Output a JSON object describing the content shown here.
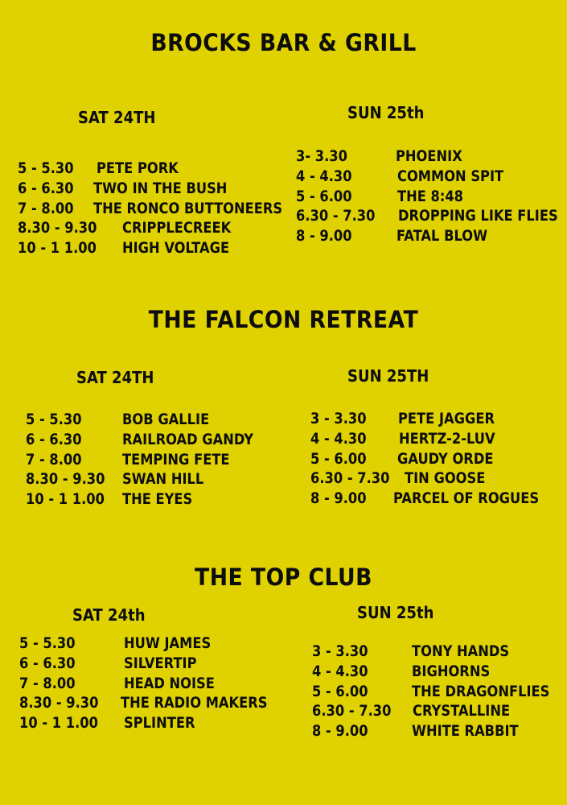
{
  "venues": [
    {
      "name": "BROCKS BAR & GRILL",
      "days": [
        {
          "label": "SAT 24TH",
          "slots": [
            {
              "time": "5 - 5.30",
              "band": "PETE PORK"
            },
            {
              "time": "6 - 6.30",
              "band": "TWO IN THE BUSH"
            },
            {
              "time": "7 - 8.00",
              "band": "THE RONCO BUTTONEERS"
            },
            {
              "time": "8.30 - 9.30",
              "band": "CRIPPLECREEK"
            },
            {
              "time": "10 - 1 1.00",
              "band": "HIGH VOLTAGE"
            }
          ]
        },
        {
          "label": "SUN 25th",
          "slots": [
            {
              "time": "3- 3.30",
              "band": "PHOENIX"
            },
            {
              "time": "4 - 4.30",
              "band": "COMMON SPIT"
            },
            {
              "time": "5 - 6.00",
              "band": "THE 8:48"
            },
            {
              "time": "6.30 - 7.30",
              "band": "DROPPING LIKE FLIES"
            },
            {
              "time": "8 - 9.00",
              "band": "FATAL BLOW"
            }
          ]
        }
      ]
    },
    {
      "name": "THE FALCON RETREAT",
      "days": [
        {
          "label": "SAT 24TH",
          "slots": [
            {
              "time": "5 - 5.30",
              "band": "BOB GALLIE"
            },
            {
              "time": "6 - 6.30",
              "band": "RAILROAD GANDY"
            },
            {
              "time": "7 - 8.00",
              "band": "TEMPING FETE"
            },
            {
              "time": "8.30 - 9.30",
              "band": "SWAN HILL"
            },
            {
              "time": "10 - 1 1.00",
              "band": "THE EYES"
            }
          ]
        },
        {
          "label": "SUN 25TH",
          "slots": [
            {
              "time": "3 - 3.30",
              "band": "PETE JAGGER"
            },
            {
              "time": "4 - 4.30",
              "band": "HERTZ-2-LUV"
            },
            {
              "time": "5 - 6.00",
              "band": "GAUDY ORDE"
            },
            {
              "time": "6.30 - 7.30",
              "band": "TIN GOOSE"
            },
            {
              "time": "8 - 9.00",
              "band": "PARCEL OF ROGUES"
            }
          ]
        }
      ]
    },
    {
      "name": "THE TOP CLUB",
      "days": [
        {
          "label": "SAT 24th",
          "slots": [
            {
              "time": "5 - 5.30",
              "band": "HUW JAMES"
            },
            {
              "time": "6 - 6.30",
              "band": "SILVERTIP"
            },
            {
              "time": "7 - 8.00",
              "band": "HEAD NOISE"
            },
            {
              "time": "8.30 - 9.30",
              "band": "THE RADIO MAKERS"
            },
            {
              "time": "10 - 1 1.00",
              "band": "SPLINTER"
            }
          ]
        },
        {
          "label": "SUN 25th",
          "slots": [
            {
              "time": "3 - 3.30",
              "band": "TONY HANDS"
            },
            {
              "time": "4 - 4.30",
              "band": "BIGHORNS"
            },
            {
              "time": "5 - 6.00",
              "band": "THE DRAGONFLIES"
            },
            {
              "time": "6.30 - 7.30",
              "band": "CRYSTALLINE"
            },
            {
              "time": "8 - 9.00",
              "band": "WHITE RABBIT"
            }
          ]
        }
      ]
    }
  ]
}
